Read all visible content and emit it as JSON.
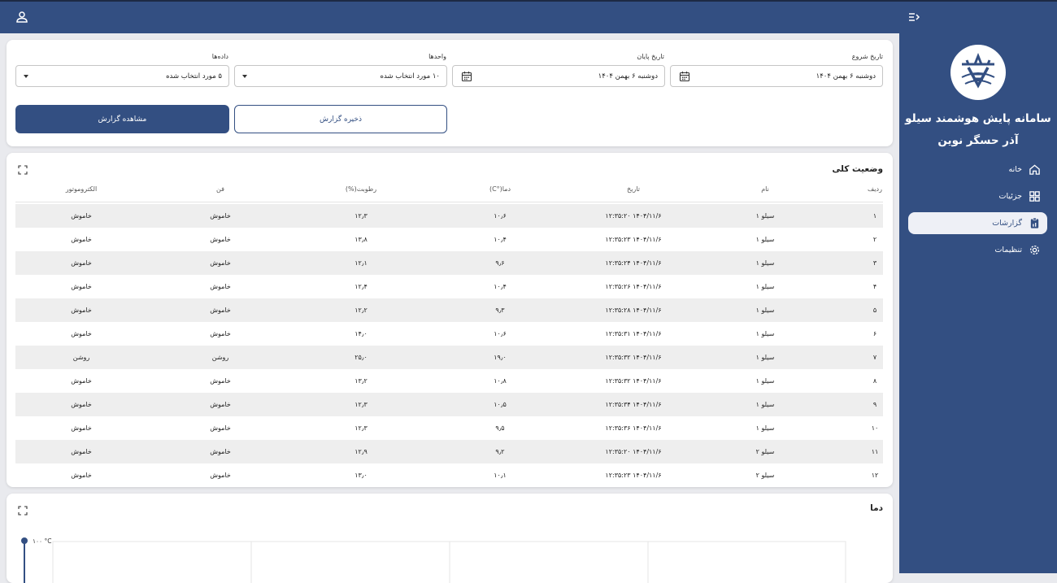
{
  "app": {
    "title_line1": "سامانه پایش هوشمند سیلو",
    "title_line2": "آذر حسگر نوین"
  },
  "nav": [
    {
      "label": "خانه",
      "icon": "home-icon",
      "active": false
    },
    {
      "label": "جزئیات",
      "icon": "grid-icon",
      "active": false
    },
    {
      "label": "گزارشات",
      "icon": "report-icon",
      "active": true
    },
    {
      "label": "تنظیمات",
      "icon": "settings-icon",
      "active": false
    }
  ],
  "filters": {
    "start_date": {
      "label": "تاریخ شروع",
      "value": "دوشنبه ۶ بهمن ۱۴۰۴"
    },
    "end_date": {
      "label": "تاریخ پایان",
      "value": "دوشنبه ۶ بهمن ۱۴۰۴"
    },
    "units": {
      "label": "واحدها",
      "value": "۱۰ مورد انتخاب شده"
    },
    "data": {
      "label": "داده‌ها",
      "value": "۵ مورد انتخاب شده"
    }
  },
  "actions": {
    "view_report": "مشاهده گزارش",
    "save_report": "ذخیره گزارش"
  },
  "status_card": {
    "title": "وضعیت کلی",
    "columns": [
      "ردیف",
      "نام",
      "تاریخ",
      "دما(°C)",
      "رطوبت(%)",
      "فن",
      "الکتروموتور"
    ],
    "rows": [
      [
        "۱",
        "سیلو ۱",
        "۱۴۰۴/۱۱/۶ ۱۲:۳۵:۲۰",
        "۱۰٫۶",
        "۱۲٫۳",
        "خاموش",
        "خاموش"
      ],
      [
        "۲",
        "سیلو ۱",
        "۱۴۰۴/۱۱/۶ ۱۲:۳۵:۲۳",
        "۱۰٫۴",
        "۱۳٫۸",
        "خاموش",
        "خاموش"
      ],
      [
        "۳",
        "سیلو ۱",
        "۱۴۰۴/۱۱/۶ ۱۲:۳۵:۲۴",
        "۹٫۶",
        "۱۲٫۱",
        "خاموش",
        "خاموش"
      ],
      [
        "۴",
        "سیلو ۱",
        "۱۴۰۴/۱۱/۶ ۱۲:۳۵:۲۶",
        "۱۰٫۴",
        "۱۲٫۴",
        "خاموش",
        "خاموش"
      ],
      [
        "۵",
        "سیلو ۱",
        "۱۴۰۴/۱۱/۶ ۱۲:۳۵:۲۸",
        "۹٫۳",
        "۱۲٫۲",
        "خاموش",
        "خاموش"
      ],
      [
        "۶",
        "سیلو ۱",
        "۱۴۰۴/۱۱/۶ ۱۲:۳۵:۳۱",
        "۱۰٫۶",
        "۱۴٫۰",
        "خاموش",
        "خاموش"
      ],
      [
        "۷",
        "سیلو ۱",
        "۱۴۰۴/۱۱/۶ ۱۲:۳۵:۳۲",
        "۱۹٫۰",
        "۲۵٫۰",
        "روشن",
        "روشن"
      ],
      [
        "۸",
        "سیلو ۱",
        "۱۴۰۴/۱۱/۶ ۱۲:۳۵:۳۲",
        "۱۰٫۸",
        "۱۳٫۲",
        "خاموش",
        "خاموش"
      ],
      [
        "۹",
        "سیلو ۱",
        "۱۴۰۴/۱۱/۶ ۱۲:۳۵:۳۴",
        "۱۰٫۵",
        "۱۲٫۳",
        "خاموش",
        "خاموش"
      ],
      [
        "۱۰",
        "سیلو ۱",
        "۱۴۰۴/۱۱/۶ ۱۲:۳۵:۳۶",
        "۹٫۵",
        "۱۲٫۳",
        "خاموش",
        "خاموش"
      ],
      [
        "۱۱",
        "سیلو ۲",
        "۱۴۰۴/۱۱/۶ ۱۲:۳۵:۲۰",
        "۹٫۲",
        "۱۲٫۹",
        "خاموش",
        "خاموش"
      ],
      [
        "۱۲",
        "سیلو ۲",
        "۱۴۰۴/۱۱/۶ ۱۲:۳۵:۲۳",
        "۱۰٫۱",
        "۱۳٫۰",
        "خاموش",
        "خاموش"
      ]
    ]
  },
  "temp_card": {
    "title": "دما",
    "y_top_label": "۱۰۰ °C"
  },
  "colors": {
    "primary": "#334f82",
    "row_alt": "#eeeeee",
    "background": "#e9eaee"
  }
}
